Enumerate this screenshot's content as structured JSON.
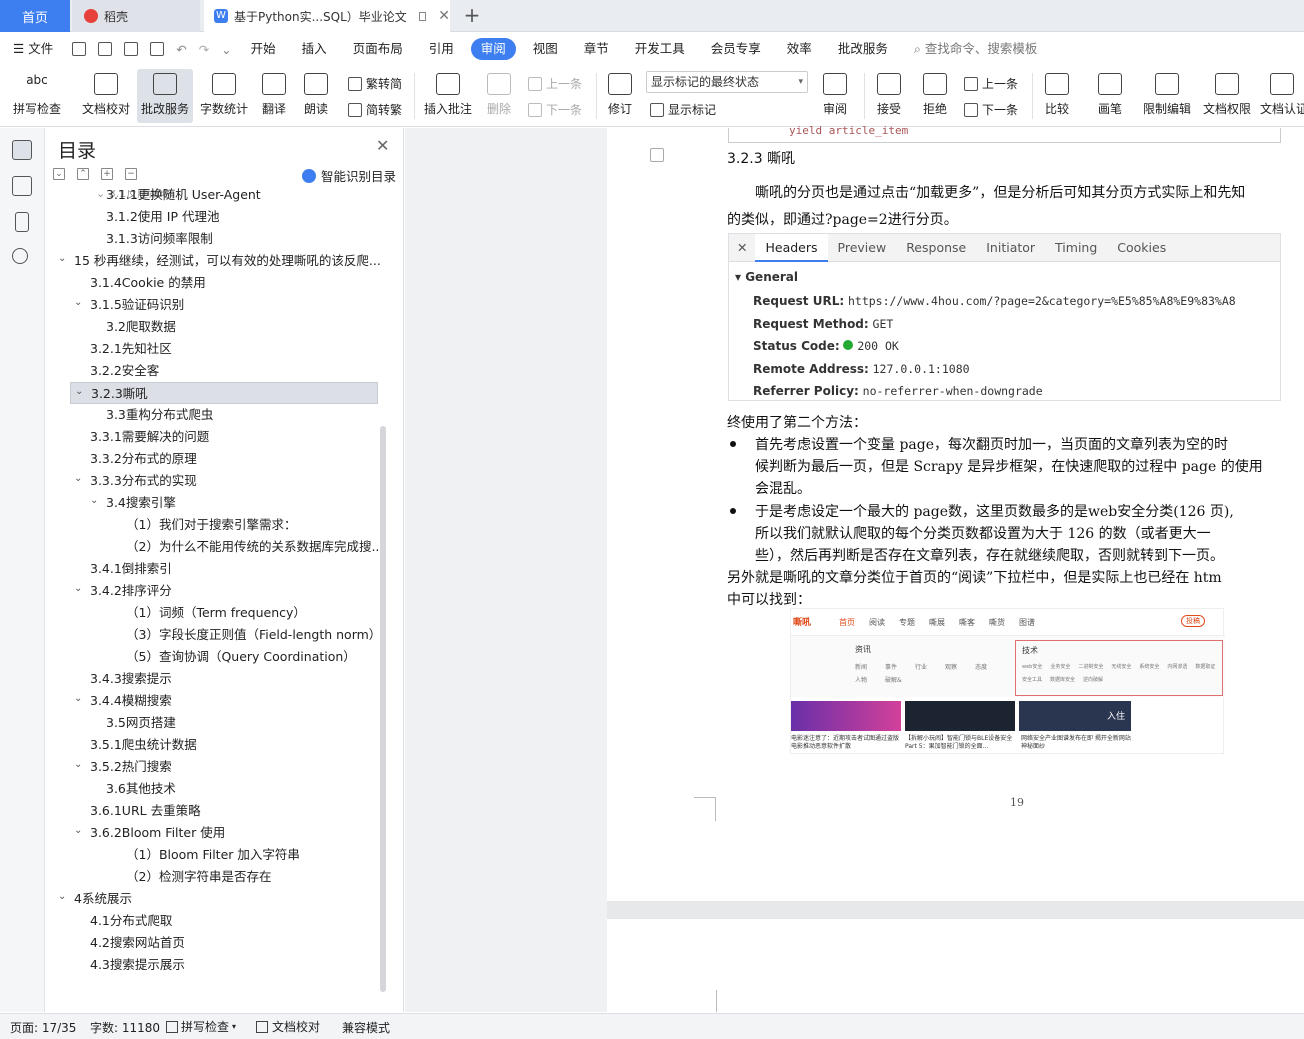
{
  "tabs": {
    "home": "首页",
    "daoke": "稻壳",
    "doc": "基于Python实...SQL）毕业论文"
  },
  "menu": {
    "file": "文件",
    "items": [
      "开始",
      "插入",
      "页面布局",
      "引用",
      "审阅",
      "视图",
      "章节",
      "开发工具",
      "会员专享",
      "效率",
      "批改服务"
    ],
    "search": "查找命令、搜索模板"
  },
  "ribbon": {
    "spell": "拼写检查",
    "doccheck": "文档校对",
    "correct": "批改服务",
    "wordcount": "字数统计",
    "translate": "翻译",
    "read": "朗读",
    "t2s": "繁转简",
    "s2t": "简转繁",
    "insert_comment": "插入批注",
    "delete": "删除",
    "prev": "上一条",
    "next": "下一条",
    "revise": "修订",
    "mark_state": "显示标记的最终状态",
    "show_marks": "显示标记",
    "review": "审阅",
    "accept": "接受",
    "reject": "拒绝",
    "prev2": "上一条",
    "next2": "下一条",
    "compare": "比较",
    "pen": "画笔",
    "restrict": "限制编辑",
    "perm": "文档权限",
    "cert": "文档认证"
  },
  "toc": {
    "title": "目录",
    "smart": "智能识别目录",
    "items": [
      {
        "t": "3.1.1更换随机 User-Agent",
        "l": 3
      },
      {
        "t": "3.1.2使用 IP 代理池",
        "l": 3
      },
      {
        "t": "3.1.3访问频率限制",
        "l": 3
      },
      {
        "t": "15 秒再继续，经测试，可以有效的处理嘶吼的该反爬...",
        "l": 1,
        "c": 1
      },
      {
        "t": "3.1.4Cookie 的禁用",
        "l": 2
      },
      {
        "t": "3.1.5验证码识别",
        "l": 2,
        "c": 1
      },
      {
        "t": "3.2爬取数据",
        "l": 3
      },
      {
        "t": "3.2.1先知社区",
        "l": 2
      },
      {
        "t": "3.2.2安全客",
        "l": 2
      },
      {
        "t": "3.2.3嘶吼",
        "l": 2,
        "c": 1,
        "sel": 1
      },
      {
        "t": "3.3重构分布式爬虫",
        "l": 3
      },
      {
        "t": "3.3.1需要解决的问题",
        "l": 2
      },
      {
        "t": "3.3.2分布式的原理",
        "l": 2
      },
      {
        "t": "3.3.3分布式的实现",
        "l": 2,
        "c": 1
      },
      {
        "t": "3.4搜索引擎",
        "l": 3,
        "c": 1
      },
      {
        "t": "（1）我们对于搜索引擎需求：",
        "l": 4
      },
      {
        "t": "（2）为什么不能用传统的关系数据库完成搜...",
        "l": 4
      },
      {
        "t": "3.4.1倒排索引",
        "l": 2
      },
      {
        "t": "3.4.2排序评分",
        "l": 2,
        "c": 1
      },
      {
        "t": "（1）词频（Term frequency）",
        "l": 4
      },
      {
        "t": "（3）字段长度正则值（Field-length norm）",
        "l": 4
      },
      {
        "t": "（5）查询协调（Query Coordination）",
        "l": 4
      },
      {
        "t": "3.4.3搜索提示",
        "l": 2
      },
      {
        "t": "3.4.4模糊搜索",
        "l": 2,
        "c": 1
      },
      {
        "t": "3.5网页搭建",
        "l": 3
      },
      {
        "t": "3.5.1爬虫统计数据",
        "l": 2
      },
      {
        "t": "3.5.2热门搜索",
        "l": 2,
        "c": 1
      },
      {
        "t": "3.6其他技术",
        "l": 3
      },
      {
        "t": "3.6.1URL 去重策略",
        "l": 2
      },
      {
        "t": "3.6.2Bloom Filter 使用",
        "l": 2,
        "c": 1
      },
      {
        "t": "（1）Bloom Filter 加入字符串",
        "l": 4
      },
      {
        "t": "（2）检测字符串是否存在",
        "l": 4
      },
      {
        "t": "4系统展示",
        "l": 1,
        "c": 1
      },
      {
        "t": "4.1分布式爬取",
        "l": 2
      },
      {
        "t": "4.2搜索网站首页",
        "l": 2
      },
      {
        "t": "4.3搜索提示展示",
        "l": 2
      }
    ]
  },
  "doc": {
    "code_tail": "yield article_item",
    "heading": "3.2.3  嘶吼",
    "p1a": "嘶吼的分页也是通过点击“加载更多”，但是分析后可知其分页方式实际上和先知",
    "p1b": "的类似，即通过?page=2进行分页。",
    "net": {
      "tabs": [
        "Headers",
        "Preview",
        "Response",
        "Initiator",
        "Timing",
        "Cookies"
      ],
      "section": "General",
      "rows": [
        {
          "k": "Request URL:",
          "v": "https://www.4hou.com/?page=2&category=%E5%85%A8%E9%83%A8"
        },
        {
          "k": "Request Method:",
          "v": "GET"
        },
        {
          "k": "Status Code:",
          "v": "200  OK"
        },
        {
          "k": "Remote Address:",
          "v": "127.0.0.1:1080"
        },
        {
          "k": "Referrer Policy:",
          "v": "no-referrer-when-downgrade"
        }
      ]
    },
    "p2": "终使用了第二个方法：",
    "b1a": "首先考虑设置一个变量 page，每次翻页时加一，当页面的文章列表为空的时",
    "b1b": "候判断为最后一页，但是 Scrapy 是异步框架，在快速爬取的过程中 page 的使用",
    "b1c": "会混乱。",
    "b2a": "于是考虑设定一个最大的 page数，这里页数最多的是web安全分类(126 页),",
    "b2b": "所以我们就默认爬取的每个分类页数都设置为大于 126 的数（或者更大一",
    "b2c": "些），然后再判断是否存在文章列表，存在就继续爬取，否则就转到下一页。",
    "p3a": "另外就是嘶吼的文章分类位于首页的“阅读”下拉栏中，但是实际上也已经在 htm",
    "p3b": "中可以找到：",
    "page_no": "19",
    "shot": {
      "logo": "嘶吼",
      "nav": [
        "首页",
        "阅读",
        "专题",
        "嘶展",
        "嘶客",
        "嘶货",
        "图谱"
      ],
      "login": "投稿",
      "col1": "资讯",
      "c1": [
        "新闻",
        "事件",
        "行业",
        "观察",
        "态度",
        "人物",
        "破解&"
      ],
      "col2": "技术",
      "c2": [
        "web安全",
        "业务安全",
        "二进制安全",
        "无线安全",
        "系统安全",
        "内网渗透",
        "数据取证",
        "安全工具",
        "数据库安全",
        "逆向破解"
      ],
      "cap1": "电影迷注意了：近期攻击者试图通过盗版电影推动恶意软件扩散",
      "cap2": "【拆解小玩闹】智能门锁与BLE设备安全Part 5：果加智能门锁的全面...",
      "cap3": "网络安全产业图谱发布在即 揭开全新网站神秘面纱",
      "card3": "入住"
    }
  },
  "status": {
    "page": "页面: 17/35",
    "words": "字数: 11180",
    "spell": "拼写检查",
    "doccheck": "文档校对",
    "compat": "兼容模式"
  },
  "colors": {
    "accent": "#3d7ef0"
  }
}
